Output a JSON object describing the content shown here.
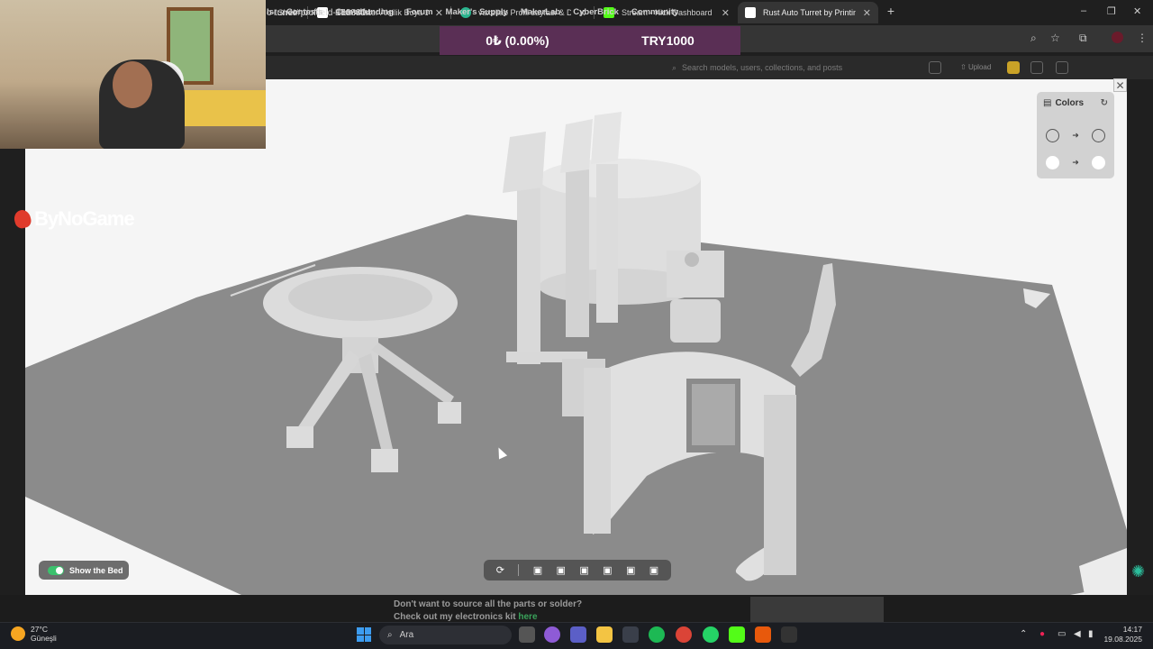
{
  "browser": {
    "tabs": [
      {
        "title": "l Shee",
        "favicon_color": "#1f1f1f"
      },
      {
        "title": "Rich Master Akrilik Boya 120 ml",
        "favicon_color": "#ffffff"
      },
      {
        "title": "vaxellab Profil sayfası & Dolap",
        "favicon_color": "#2bb58f"
      },
      {
        "title": "Stream - Kick Dashboard",
        "favicon_color": "#53fc18"
      },
      {
        "title": "Rust Auto Turret by Printing By",
        "favicon_color": "#ffffff"
      }
    ],
    "new_tab_glyph": "+",
    "url": "o-turret#profileId-1588804",
    "window_controls": [
      "–",
      "❐",
      "✕"
    ]
  },
  "donation_overlay": {
    "amount": "0₺ (0.00%)",
    "goal": "TRY1000"
  },
  "site_nav": {
    "items": [
      "ls",
      "Contests",
      "Crowdfunding",
      "Forum",
      "Maker's Supply",
      "MakerLab",
      "CyberBrick",
      "Community"
    ],
    "search_placeholder": "Search models, users, collections, and posts",
    "upload_label": "Upload"
  },
  "viewer": {
    "close_glyph": "✕",
    "colors_title": "Colors",
    "show_bed_label": "Show the Bed",
    "show_bed_on": true,
    "accent_color": "#3bc16d"
  },
  "brand": {
    "name": "ByNoGame"
  },
  "page_below": {
    "line1": "Don't want to source all the parts or solder?",
    "line2": "Check out my electronics kit",
    "link": "here"
  },
  "taskbar": {
    "temperature": "27°C",
    "weather": "Güneşli",
    "search_placeholder": "Ara",
    "time": "14:17",
    "date": "19.08.2025"
  }
}
